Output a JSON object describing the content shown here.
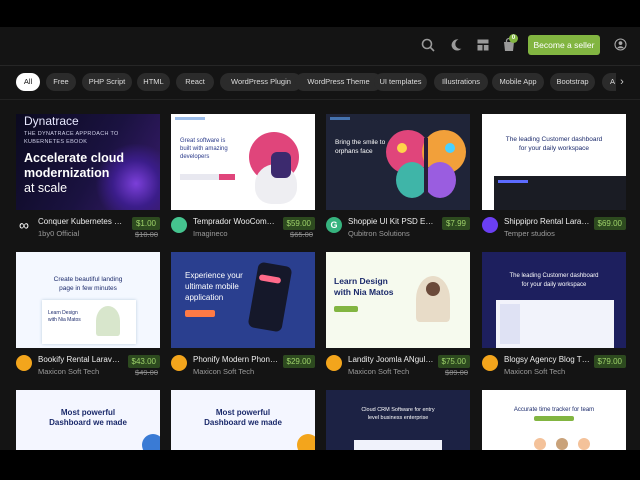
{
  "header": {
    "seller_button": "Become a seller",
    "cart_count": "0",
    "icons": [
      "search-icon",
      "moon-icon",
      "grid-icon",
      "cart-icon",
      "user-icon"
    ]
  },
  "filters": {
    "chips": [
      "All",
      "Free",
      "PHP Script",
      "HTML",
      "React",
      "WordPress Plugin",
      "WordPress Theme",
      "UI templates",
      "Illustrations",
      "Mobile App",
      "Bootstrap",
      "A"
    ],
    "active": "All"
  },
  "products": [
    {
      "title": "Conquer Kubernetes co...",
      "author": "1by0 Official",
      "price": "$1.00",
      "old_price": "$10.00",
      "thumb_text": [
        "Dynatrace",
        "THE DYNATRACE APPROACH TO",
        "KUBERNETES EBOOK",
        "Accelerate cloud",
        "modernization",
        "at scale"
      ]
    },
    {
      "title": "Temprador WooComm...",
      "author": "Imagineco",
      "price": "$59.00",
      "old_price": "$65.00",
      "thumb_text": [
        "Great software is",
        "built with amazing",
        "developers"
      ]
    },
    {
      "title": "Shoppie UI Kit PSD Eco...",
      "author": "Qubitron Solutions",
      "price": "$7.99",
      "old_price": "",
      "thumb_text": [
        "Bring the smile to",
        "orphans face"
      ]
    },
    {
      "title": "Shippipro Rental Larav...",
      "author": "Temper studios",
      "price": "$69.00",
      "old_price": "",
      "thumb_text": [
        "The leading Customer dashboard",
        "for your daily workspace"
      ]
    },
    {
      "title": "Bookify Rental Laravel R...",
      "author": "Maxicon Soft Tech",
      "price": "$43.00",
      "old_price": "$49.00",
      "thumb_text": [
        "Create beautiful landing",
        "page in few minutes",
        "Learn Design",
        "with Nia Matos"
      ]
    },
    {
      "title": "Phonify Modern Phone...",
      "author": "Maxicon Soft Tech",
      "price": "$29.00",
      "old_price": "",
      "thumb_text": [
        "Experience your",
        "ultimate mobile",
        "application"
      ]
    },
    {
      "title": "Landity Joomla ANgula...",
      "author": "Maxicon Soft Tech",
      "price": "$75.00",
      "old_price": "$89.00",
      "thumb_text": [
        "Learn Design",
        "with Nia Matos"
      ]
    },
    {
      "title": "Blogsy Agency Blog Th...",
      "author": "Maxicon Soft Tech",
      "price": "$79.00",
      "old_price": "",
      "thumb_text": [
        "The leading Customer dashboard",
        "for your daily workspace"
      ]
    },
    {
      "title": "",
      "author": "",
      "price": "",
      "old_price": "",
      "thumb_text": [
        "Most powerful",
        "Dashboard we made"
      ]
    },
    {
      "title": "",
      "author": "",
      "price": "",
      "old_price": "",
      "thumb_text": [
        "Most powerful",
        "Dashboard we made"
      ]
    },
    {
      "title": "",
      "author": "",
      "price": "",
      "old_price": "",
      "thumb_text": [
        "Cloud CRM Software for entry",
        "level business enterprise"
      ]
    },
    {
      "title": "",
      "author": "",
      "price": "",
      "old_price": "",
      "thumb_text": [
        "Accurate time tracker for team"
      ]
    }
  ],
  "colors": {
    "accent": "#82b541",
    "background": "#141414",
    "chip": "#2b2b2b"
  }
}
